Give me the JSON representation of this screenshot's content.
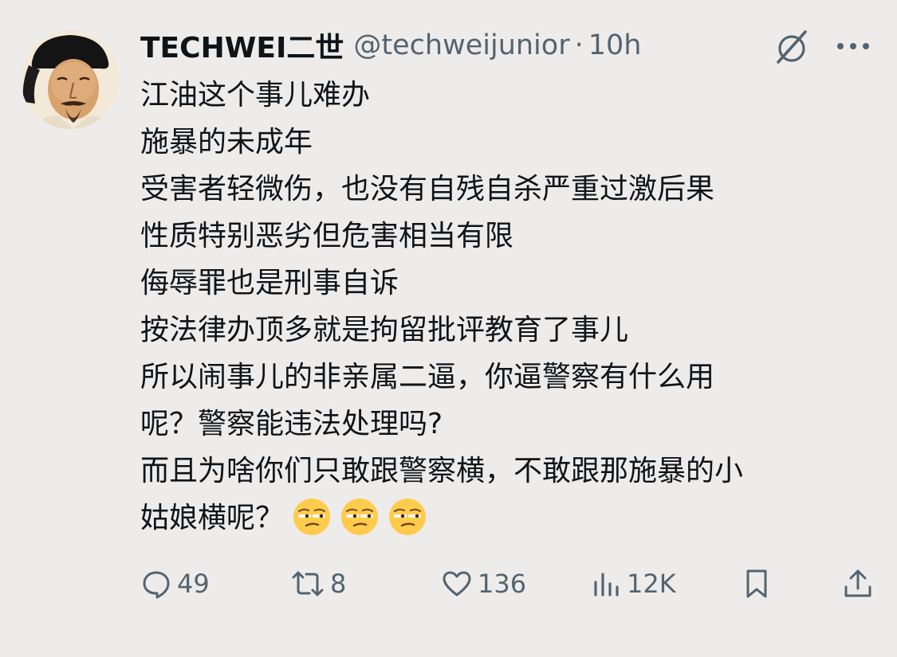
{
  "post": {
    "author": {
      "display_name": "TECHWEI二世",
      "handle": "@techweijunior",
      "separator": "·",
      "time": "10h",
      "avatar_icon": "portrait-avatar"
    },
    "lines": [
      "江油这个事儿难办",
      "施暴的未成年",
      "受害者轻微伤，也没有自残自杀严重过激后果",
      "性质特别恶劣但危害相当有限",
      "侮辱罪也是刑事自诉",
      "按法律办顶多就是拘留批评教育了事儿",
      "所以闹事儿的非亲属二逼，你逼警察有什么用",
      "呢？警察能违法处理吗?",
      "而且为啥你们只敢跟警察横，不敢跟那施暴的小",
      "姑娘横呢？"
    ],
    "emoji": [
      "unamused-face",
      "unamused-face",
      "unamused-face"
    ],
    "actions": {
      "replies": "49",
      "reposts": "8",
      "likes": "136",
      "views": "12K"
    }
  },
  "icons": {
    "header": [
      "grok-icon",
      "more-icon"
    ],
    "actions": [
      "reply-icon",
      "repost-icon",
      "like-icon",
      "views-icon",
      "bookmark-icon",
      "share-icon"
    ]
  },
  "colors": {
    "background": "#eeecea",
    "text": "#0f1419",
    "secondary": "#536471"
  }
}
